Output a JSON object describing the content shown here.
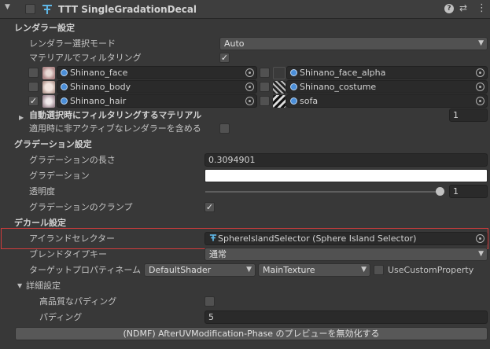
{
  "header": {
    "title": "TTT SingleGradationDecal",
    "help_icon": "help-icon",
    "settings_icon": "preset-icon",
    "menu_icon": "kebab-menu-icon"
  },
  "renderer": {
    "section": "レンダラー設定",
    "mode_label": "レンダラー選択モード",
    "mode_value": "Auto",
    "filter_label": "マテリアルでフィルタリング",
    "filter_checked": "✓",
    "materials": [
      {
        "name": "Shinano_face",
        "checked": ""
      },
      {
        "name": "Shinano_face_alpha",
        "checked": ""
      },
      {
        "name": "Shinano_body",
        "checked": ""
      },
      {
        "name": "Shinano_costume",
        "checked": ""
      },
      {
        "name": "Shinano_hair",
        "checked": "✓"
      },
      {
        "name": "sofa",
        "checked": ""
      }
    ],
    "auto_filter_label": "自動選択時にフィルタリングするマテリアル",
    "auto_filter_count": "1",
    "include_inactive_label": "適用時に非アクティブなレンダラーを含める"
  },
  "gradation": {
    "section": "グラデーション設定",
    "length_label": "グラデーションの長さ",
    "length_value": "0.3094901",
    "gradient_label": "グラデーション",
    "alpha_label": "透明度",
    "alpha_value": "1",
    "alpha_fraction": 1.0,
    "clamp_label": "グラデーションのクランプ",
    "clamp_checked": "✓"
  },
  "decal": {
    "section": "デカール設定",
    "island_label": "アイランドセレクター",
    "island_value": "SphereIslandSelector (Sphere Island Selector)",
    "blend_label": "ブレンドタイプキー",
    "blend_value": "通常",
    "target_label": "ターゲットプロパティネーム",
    "shader_value": "DefaultShader",
    "texture_value": "MainTexture",
    "use_custom_label": "UseCustomProperty",
    "advanced_label": "詳細設定",
    "hq_padding_label": "高品質なパディング",
    "padding_label": "パディング",
    "padding_value": "5"
  },
  "preview_button": "(NDMF) AfterUVModification-Phase のプレビューを無効化する"
}
